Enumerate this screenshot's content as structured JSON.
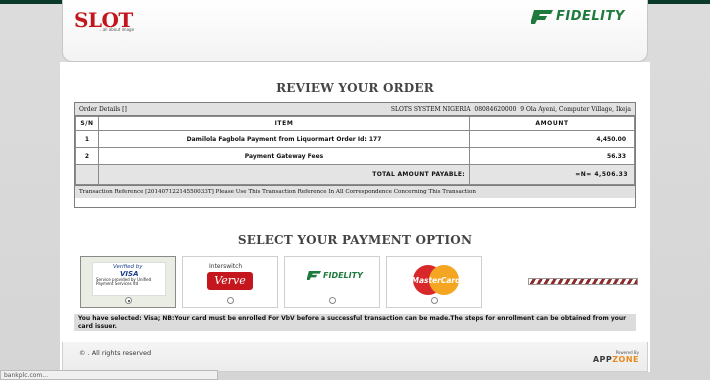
{
  "header": {
    "slot_logo": "SLOT",
    "slot_tagline": "...all about image",
    "fidelity_logo": "FIDELITY"
  },
  "review": {
    "title": "REVIEW YOUR ORDER",
    "order_details_label": "Order Details []",
    "merchant": "SLOTS SYSTEM NIGERIA",
    "merchant_phone": "08084620000",
    "merchant_address": "9 Ola Ayeni, Computer Village, Ikeja",
    "columns": {
      "sn": "S/N",
      "item": "ITEM",
      "amount": "AMOUNT"
    },
    "rows": [
      {
        "sn": "1",
        "item": "Damilola Fagbola Payment from Liquormart Order Id: 177",
        "amount": "4,450.00"
      },
      {
        "sn": "2",
        "item": "Payment Gateway Fees",
        "amount": "56.33"
      }
    ],
    "total_label": "Total Amount Payable:",
    "total_amount": "=N= 4,506.33",
    "transaction_reference": "Transaction Reference [20140712214550033T] Please Use This Transaction Reference In All Correspondence Concerning This Transaction"
  },
  "payment": {
    "title": "SELECT YOUR PAYMENT OPTION",
    "options": {
      "visa": {
        "verified_by": "Verified by",
        "brand": "VISA",
        "service": "Service provided by Unified Payment Services ltd",
        "selected": true
      },
      "verve": {
        "top": "Interswitch",
        "brand": "Verve",
        "selected": false
      },
      "fidelity": {
        "brand": "FIDELITY",
        "selected": false
      },
      "mastercard": {
        "brand": "MasterCard",
        "selected": false
      }
    },
    "notice": "You have selected: Visa;  NB:Your card must be enrolled For VbV before a successful transaction can be made.The steps for enrollment can be obtained from your card issuer."
  },
  "footer": {
    "copyright": "© . All rights reserved",
    "powered_by": "Powered By",
    "appzone_app": "APP",
    "appzone_zone": "ZONE"
  },
  "statusbar": {
    "text": "bankplc.com..."
  },
  "colors": {
    "slot_red": "#c3161c",
    "fidelity_green": "#1f7a3d",
    "top_bar": "#0c3a2a",
    "panel_gray": "#e1e1e1"
  }
}
